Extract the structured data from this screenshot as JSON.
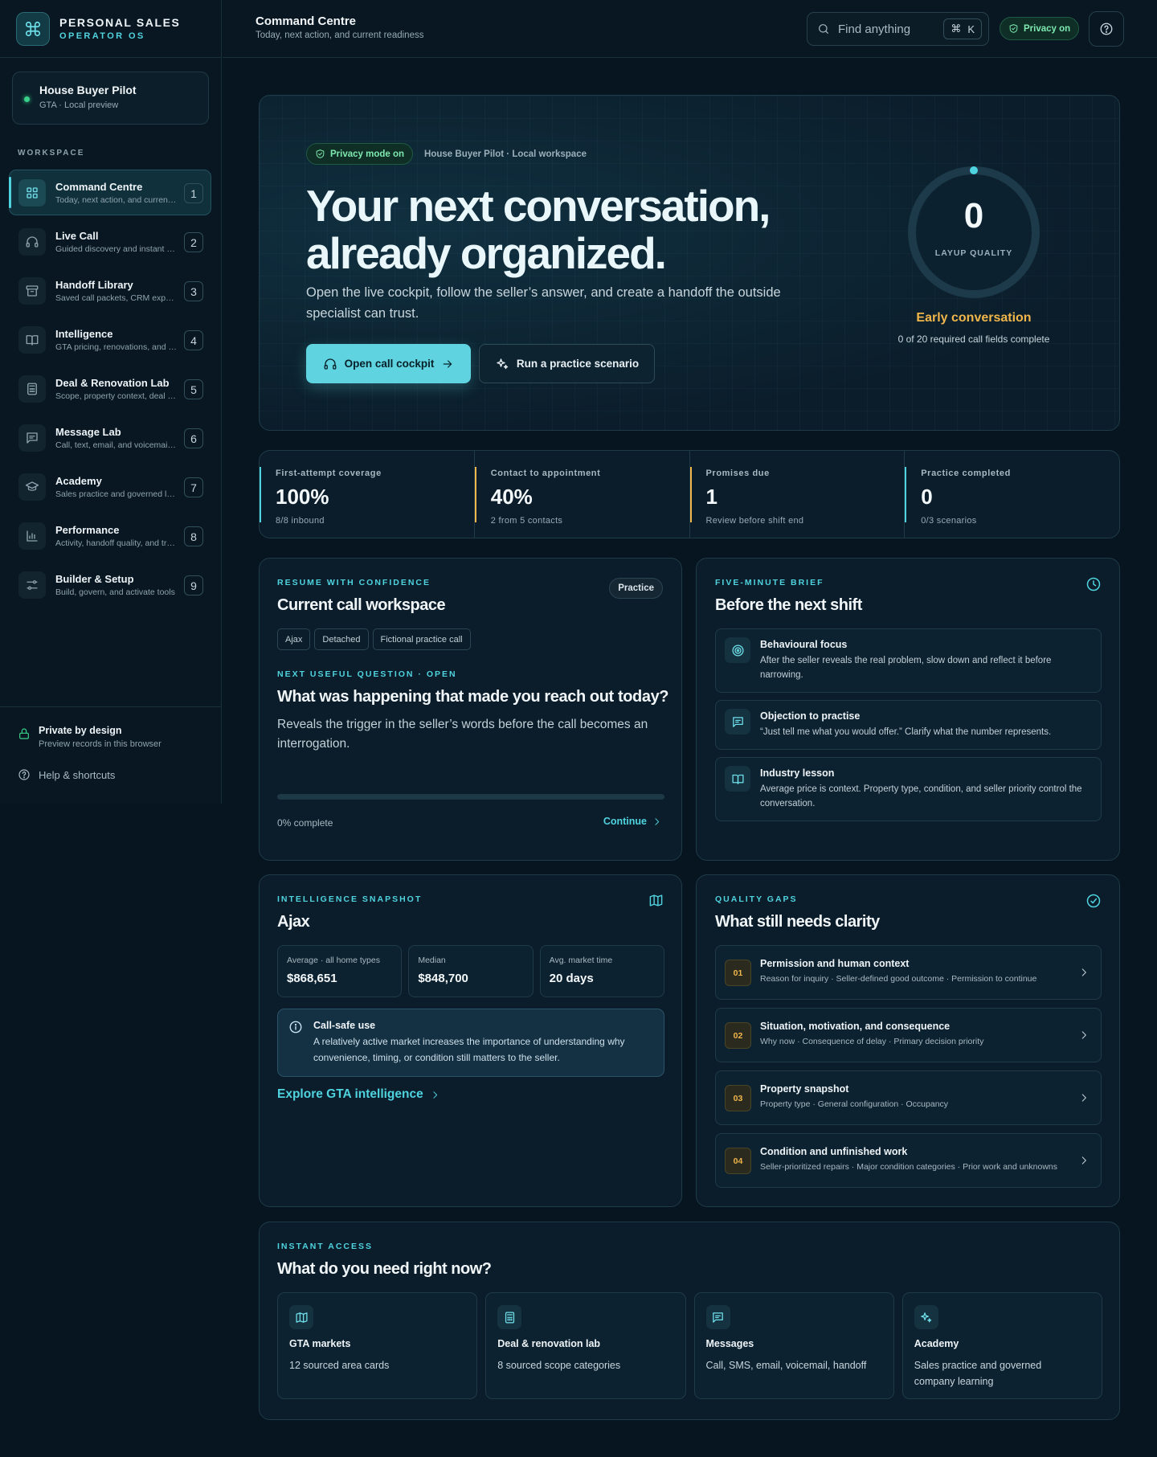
{
  "brand": {
    "title": "PERSONAL SALES",
    "subtitle": "OPERATOR OS"
  },
  "pilot": {
    "title": "House Buyer Pilot",
    "subtitle": "GTA · Local preview"
  },
  "sidebar": {
    "section_label": "WORKSPACE",
    "items": [
      {
        "title": "Command Centre",
        "subtitle": "Today, next action, and current readiness",
        "key": "1",
        "icon": "grid-icon",
        "active": true
      },
      {
        "title": "Live Call",
        "subtitle": "Guided discovery and instant notes",
        "key": "2",
        "icon": "headphones-icon",
        "active": false
      },
      {
        "title": "Handoff Library",
        "subtitle": "Saved call packets, CRM exports",
        "key": "3",
        "icon": "archive-icon",
        "active": false
      },
      {
        "title": "Intelligence",
        "subtitle": "GTA pricing, renovations, and markets",
        "key": "4",
        "icon": "book-icon",
        "active": false
      },
      {
        "title": "Deal & Renovation Lab",
        "subtitle": "Scope, property context, deal math",
        "key": "5",
        "icon": "calculator-icon",
        "active": false
      },
      {
        "title": "Message Lab",
        "subtitle": "Call, text, email, and voicemail scripts",
        "key": "6",
        "icon": "message-icon",
        "active": false
      },
      {
        "title": "Academy",
        "subtitle": "Sales practice and governed learning",
        "key": "7",
        "icon": "graduation-cap-icon",
        "active": false
      },
      {
        "title": "Performance",
        "subtitle": "Activity, handoff quality, and trends",
        "key": "8",
        "icon": "bar-chart-icon",
        "active": false
      },
      {
        "title": "Builder & Setup",
        "subtitle": "Build, govern, and activate tools",
        "key": "9",
        "icon": "sliders-icon",
        "active": false
      }
    ],
    "footer": {
      "private_title": "Private by design",
      "private_sub": "Preview records in this browser",
      "help_label": "Help & shortcuts"
    }
  },
  "topbar": {
    "title": "Command Centre",
    "subtitle": "Today, next action, and current readiness",
    "search_placeholder": "Find anything",
    "search_shortcut_symbol": "⌘",
    "search_shortcut_key": "K",
    "privacy_label": "Privacy on"
  },
  "hero": {
    "privacy_badge": "Privacy mode on",
    "workspace_label": "House Buyer Pilot · Local workspace",
    "headline_line1": "Your next conversation,",
    "headline_line2": "already organized.",
    "description": "Open the live cockpit, follow the seller’s answer, and create a handoff the outside specialist can trust.",
    "primary_button": "Open call cockpit",
    "secondary_button": "Run a practice scenario",
    "gauge_value": "0",
    "gauge_label": "LAYUP QUALITY",
    "gauge_fraction": 0,
    "gauge_status": "Early conversation",
    "gauge_description": "0 of 20 required call fields complete"
  },
  "stats": [
    {
      "label": "First-attempt coverage",
      "value": "100%",
      "sub": "8/8 inbound",
      "color": "#4fd3df"
    },
    {
      "label": "Contact to appointment",
      "value": "40%",
      "sub": "2 from 5 contacts",
      "color": "#f0b64a"
    },
    {
      "label": "Promises due",
      "value": "1",
      "sub": "Review before shift end",
      "color": "#f0b64a"
    },
    {
      "label": "Practice completed",
      "value": "0",
      "sub": "0/3 scenarios",
      "color": "#4fd3df"
    }
  ],
  "workspace_card": {
    "kicker": "RESUME WITH CONFIDENCE",
    "title": "Current call workspace",
    "badge": "Practice",
    "chips": [
      "Ajax",
      "Detached",
      "Fictional practice call"
    ],
    "question_kicker": "NEXT USEFUL QUESTION · OPEN",
    "question": "What was happening that made you reach out today?",
    "question_desc": "Reveals the trigger in the seller’s words before the call becomes an interrogation.",
    "progress_percent": 0,
    "progress_text": "0% complete",
    "continue_label": "Continue"
  },
  "brief_card": {
    "kicker": "FIVE-MINUTE BRIEF",
    "title": "Before the next shift",
    "items": [
      {
        "title": "Behavioural focus",
        "text": "After the seller reveals the real problem, slow down and reflect it before narrowing.",
        "icon": "target-icon"
      },
      {
        "title": "Objection to practise",
        "text": "“Just tell me what you would offer.” Clarify what the number represents.",
        "icon": "message-icon"
      },
      {
        "title": "Industry lesson",
        "text": "Average price is context. Property type, condition, and seller priority control the conversation.",
        "icon": "book-icon"
      }
    ]
  },
  "intel_card": {
    "kicker": "INTELLIGENCE SNAPSHOT",
    "title": "Ajax",
    "metrics": [
      {
        "label": "Average · all home types",
        "value": "$868,651"
      },
      {
        "label": "Median",
        "value": "$848,700"
      },
      {
        "label": "Avg. market time",
        "value": "20 days"
      }
    ],
    "callsafe_title": "Call-safe use",
    "callsafe_text": "A relatively active market increases the importance of understanding why convenience, timing, or condition still matters to the seller.",
    "explore_label": "Explore GTA intelligence"
  },
  "gaps_card": {
    "kicker": "QUALITY GAPS",
    "title": "What still needs clarity",
    "items": [
      {
        "num": "01",
        "title": "Permission and human context",
        "sub": "Reason for inquiry · Seller-defined good outcome · Permission to continue"
      },
      {
        "num": "02",
        "title": "Situation, motivation, and consequence",
        "sub": "Why now · Consequence of delay · Primary decision priority"
      },
      {
        "num": "03",
        "title": "Property snapshot",
        "sub": "Property type · General configuration · Occupancy"
      },
      {
        "num": "04",
        "title": "Condition and unfinished work",
        "sub": "Seller-prioritized repairs · Major condition categories · Prior work and unknowns"
      }
    ]
  },
  "access_card": {
    "kicker": "INSTANT ACCESS",
    "title": "What do you need right now?",
    "tiles": [
      {
        "title": "GTA markets",
        "desc": "12 sourced area cards",
        "icon": "map-icon"
      },
      {
        "title": "Deal & renovation lab",
        "desc": "8 sourced scope categories",
        "icon": "calculator-icon"
      },
      {
        "title": "Messages",
        "desc": "Call, SMS, email, voicemail, handoff",
        "icon": "message-icon"
      },
      {
        "title": "Academy",
        "desc": "Sales practice and governed company learning",
        "icon": "sparkles-icon"
      }
    ]
  }
}
